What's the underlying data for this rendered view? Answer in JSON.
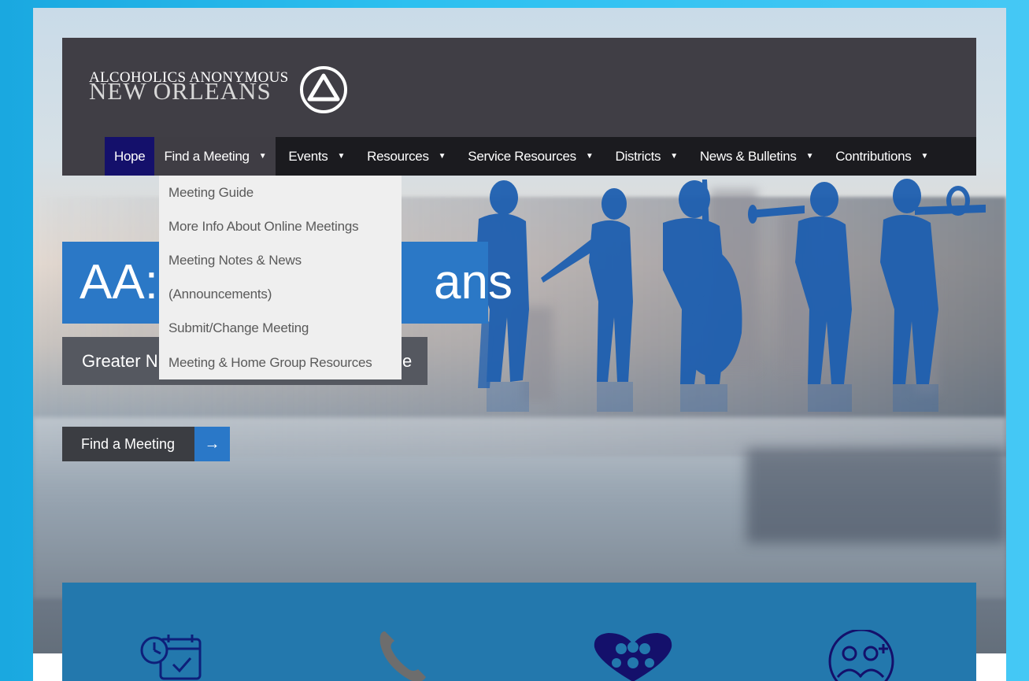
{
  "logo": {
    "line1": "ALCOHOLICS ANONYMOUS",
    "line2": "NEW ORLEANS",
    "mark_icon": "aa-circle-triangle-icon"
  },
  "nav": {
    "items": [
      {
        "label": "Hope",
        "caret": ""
      },
      {
        "label": "Find a Meeting",
        "caret": "▼"
      },
      {
        "label": "Events",
        "caret": "▼"
      },
      {
        "label": "Resources",
        "caret": "▼"
      },
      {
        "label": "Service Resources",
        "caret": "▼"
      },
      {
        "label": "Districts",
        "caret": "▼"
      },
      {
        "label": "News & Bulletins",
        "caret": "▼"
      },
      {
        "label": "Contributions",
        "caret": "▼"
      }
    ]
  },
  "dropdown": {
    "items": [
      "Meeting Guide",
      "More Info About Online Meetings",
      "Meeting Notes & News",
      "(Announcements)",
      "Submit/Change Meeting",
      "Meeting & Home Group Resources"
    ]
  },
  "hero": {
    "title_visible_left": "AA:",
    "title_visible_right": "ans",
    "subtitle_visible_left": "Greater N",
    "subtitle_visible_right": "e"
  },
  "cta": {
    "label": "Find a Meeting",
    "arrow_icon": "arrow-right-icon"
  },
  "panel_icons": [
    "calendar-clock-icon",
    "phone-icon",
    "heart-people-icon",
    "medical-people-icon"
  ],
  "colors": {
    "header_bg": "#403e45",
    "nav_bg": "#1b1b1f",
    "hope_bg": "#14106b",
    "accent_blue": "#2b78c6",
    "panel_blue": "#2378ad",
    "silhouette_blue": "#1e5fb0"
  }
}
